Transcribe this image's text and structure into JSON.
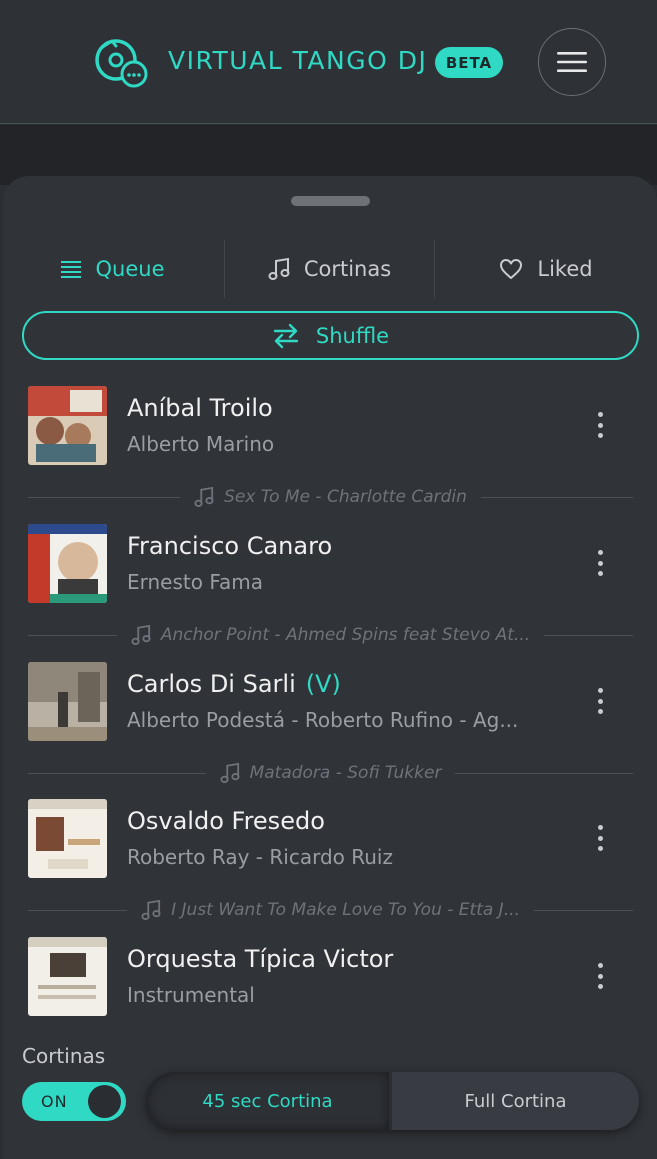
{
  "header": {
    "title": "VIRTUAL TANGO DJ",
    "badge": "BETA",
    "logo_icon": "vinyl-chat-icon",
    "menu_icon": "hamburger-icon"
  },
  "tabs": [
    {
      "label": "Queue",
      "icon": "list-icon",
      "active": true
    },
    {
      "label": "Cortinas",
      "icon": "music-note-icon",
      "active": false
    },
    {
      "label": "Liked",
      "icon": "heart-icon",
      "active": false
    }
  ],
  "shuffle": {
    "label": "Shuffle",
    "icon": "swap-arrows-icon"
  },
  "queue": [
    {
      "title": "Aníbal Troilo",
      "vals": "",
      "subtitle": "Alberto Marino"
    },
    {
      "title": "Francisco Canaro",
      "vals": "",
      "subtitle": "Ernesto Fama"
    },
    {
      "title": "Carlos Di Sarli",
      "vals": "(V)",
      "subtitle": "Alberto Podestá - Roberto Rufino - Ag..."
    },
    {
      "title": "Osvaldo Fresedo",
      "vals": "",
      "subtitle": "Roberto Ray - Ricardo Ruiz"
    },
    {
      "title": "Orquesta Típica Victor",
      "vals": "",
      "subtitle": "Instrumental"
    }
  ],
  "cortinas_between": [
    "Sex To Me - Charlotte Cardin",
    "Anchor Point - Ahmed Spins feat Stevo At...",
    "Matadora - Sofi Tukker",
    "I Just Want To Make Love To You - Etta J..."
  ],
  "cortina_controls": {
    "label": "Cortinas",
    "toggle_text": "ON",
    "toggle_on": true,
    "options": [
      "45 sec Cortina",
      "Full Cortina"
    ],
    "selected": "45 sec Cortina"
  },
  "colors": {
    "accent": "#2fd9c4",
    "background": "#2b2e33",
    "sheet": "#303338"
  }
}
